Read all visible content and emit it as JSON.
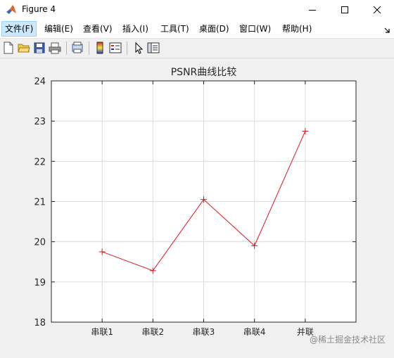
{
  "window": {
    "title": "Figure 4",
    "minimize_icon": "minimize-icon",
    "maximize_icon": "maximize-icon",
    "close_icon": "close-icon"
  },
  "menubar": {
    "items": [
      "文件(F)",
      "编辑(E)",
      "查看(V)",
      "插入(I)",
      "工具(T)",
      "桌面(D)",
      "窗口(W)",
      "帮助(H)"
    ],
    "active_index": 0,
    "dock_icon": "dock-arrow-icon"
  },
  "toolbar": {
    "icons": [
      "new-figure-icon",
      "open-file-icon",
      "save-icon",
      "print-icon",
      "print-preview-icon",
      "colorbar-icon",
      "legend-icon",
      "pointer-icon",
      "property-editor-icon"
    ]
  },
  "chart_data": {
    "type": "line",
    "title": "PSNR曲线比较",
    "xlabel": "",
    "ylabel": "",
    "categories": [
      "串联1",
      "串联2",
      "串联3",
      "串联4",
      "并联"
    ],
    "series": [
      {
        "values": [
          19.75,
          19.28,
          21.05,
          19.9,
          22.75
        ],
        "color": "#e8141e",
        "marker": "+"
      }
    ],
    "ylim": [
      18,
      24
    ],
    "yticks": [
      "18",
      "19",
      "20",
      "21",
      "22",
      "23",
      "24"
    ],
    "grid": true
  },
  "watermark": "@稀土掘金技术社区"
}
